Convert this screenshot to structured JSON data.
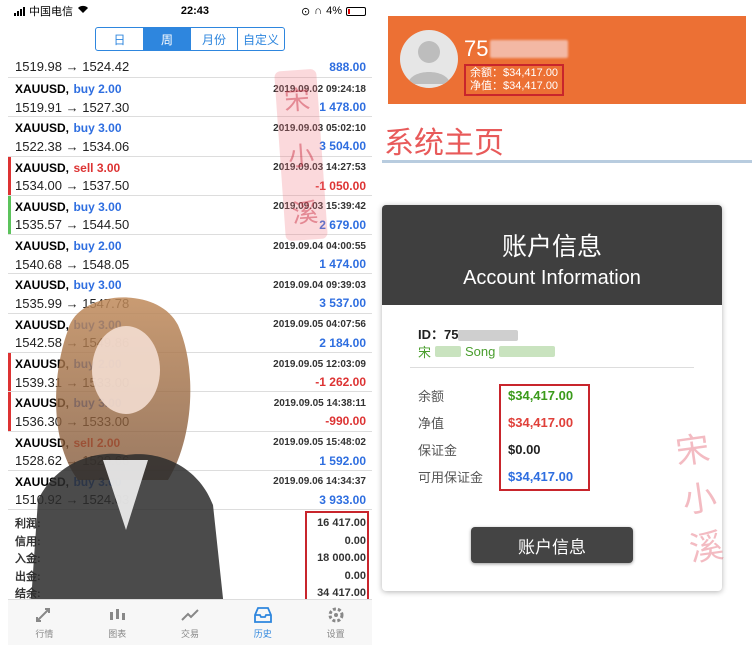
{
  "status_bar": {
    "carrier": "中国电信",
    "time": "22:43",
    "battery": "4%"
  },
  "period_tabs": [
    {
      "label": "日",
      "active": false
    },
    {
      "label": "周",
      "active": true
    },
    {
      "label": "月份",
      "active": false
    },
    {
      "label": "自定义",
      "active": false
    }
  ],
  "first_row": {
    "prices": "1519.98 → 1524.42",
    "profit": "888.00"
  },
  "trades": [
    {
      "symbol": "XAUUSD,",
      "side": "buy 2.00",
      "type": "buy",
      "time": "2019.09.02 09:24:18",
      "prices": "1519.91 → 1527.30",
      "profit": "1 478.00",
      "sign": "pos"
    },
    {
      "symbol": "XAUUSD,",
      "side": "buy 3.00",
      "type": "buy",
      "time": "2019.09.03 05:02:10",
      "prices": "1522.38 → 1534.06",
      "profit": "3 504.00",
      "sign": "pos"
    },
    {
      "symbol": "XAUUSD,",
      "side": "sell 3.00",
      "type": "sell",
      "time": "2019.09.03 14:27:53",
      "prices": "1534.00 → 1537.50",
      "profit": "-1 050.00",
      "sign": "neg",
      "bar": "#d33"
    },
    {
      "symbol": "XAUUSD,",
      "side": "buy 3.00",
      "type": "buy",
      "time": "2019.09.03 15:39:42",
      "prices": "1535.57 → 1544.50",
      "profit": "2 679.00",
      "sign": "pos",
      "bar": "#5cc35c"
    },
    {
      "symbol": "XAUUSD,",
      "side": "buy 2.00",
      "type": "buy",
      "time": "2019.09.04 04:00:55",
      "prices": "1540.68 → 1548.05",
      "profit": "1 474.00",
      "sign": "pos"
    },
    {
      "symbol": "XAUUSD,",
      "side": "buy 3.00",
      "type": "buy",
      "time": "2019.09.04 09:39:03",
      "prices": "1535.99 → 1547.78",
      "profit": "3 537.00",
      "sign": "pos"
    },
    {
      "symbol": "XAUUSD,",
      "side": "buy 3.00",
      "type": "buy",
      "time": "2019.09.05 04:07:56",
      "prices": "1542.58 → 1549.86",
      "profit": "2 184.00",
      "sign": "pos"
    },
    {
      "symbol": "XAUUSD,",
      "side": "buy 2.00",
      "type": "buy",
      "time": "2019.09.05 12:03:09",
      "prices": "1539.31 → 1533.00",
      "profit": "-1 262.00",
      "sign": "neg",
      "bar": "#d33"
    },
    {
      "symbol": "XAUUSD,",
      "side": "buy 3.00",
      "type": "buy",
      "time": "2019.09.05 14:38:11",
      "prices": "1536.30 → 1533.00",
      "profit": "-990.00",
      "sign": "neg",
      "bar": "#d33"
    },
    {
      "symbol": "XAUUSD,",
      "side": "sell 2.00",
      "type": "sell",
      "time": "2019.09.05 15:48:02",
      "prices": "1528.62 → 1520.66",
      "profit": "1 592.00",
      "sign": "pos"
    },
    {
      "symbol": "XAUUSD,",
      "side": "buy 3.00",
      "type": "buy",
      "time": "2019.09.06 14:34:37",
      "prices": "1510.92 → 1524.03",
      "profit": "3 933.00",
      "sign": "pos"
    }
  ],
  "summary": [
    {
      "label": "利润:",
      "value": "16 417.00"
    },
    {
      "label": "信用:",
      "value": "0.00"
    },
    {
      "label": "入金:",
      "value": "18 000.00"
    },
    {
      "label": "出金:",
      "value": "0.00"
    },
    {
      "label": "结余:",
      "value": "34 417.00"
    }
  ],
  "bottom_tabs": [
    {
      "label": "行情",
      "icon": "quotes-icon",
      "active": false
    },
    {
      "label": "图表",
      "icon": "chart-icon",
      "active": false
    },
    {
      "label": "交易",
      "icon": "trade-icon",
      "active": false
    },
    {
      "label": "历史",
      "icon": "history-icon",
      "active": true
    },
    {
      "label": "设置",
      "icon": "settings-icon",
      "active": false
    }
  ],
  "profile": {
    "id_prefix": "75",
    "balance_line": "余额：$34,417.00",
    "equity_line": "净值：$34,417.00"
  },
  "page_title": "系统主页",
  "account_card": {
    "title_cn": "账户信息",
    "title_en": "Account Information",
    "id_label": "ID：75",
    "name_prefix": "宋",
    "name_middle": "Song",
    "rows": [
      {
        "label": "余额",
        "value": "$34,417.00",
        "color": "#3a9a1a"
      },
      {
        "label": "净值",
        "value": "$34,417.00",
        "color": "#e0403a"
      },
      {
        "label": "保证金",
        "value": "$0.00",
        "color": "#222222"
      },
      {
        "label": "可用保证金",
        "value": "$34,417.00",
        "color": "#2e6ee0"
      }
    ],
    "button_label": "账户信息"
  },
  "colors": {
    "accent": "#2e86de",
    "header_orange": "#ec7034",
    "highlight_red": "#c8252c",
    "card_dark": "#3f3f3f"
  }
}
